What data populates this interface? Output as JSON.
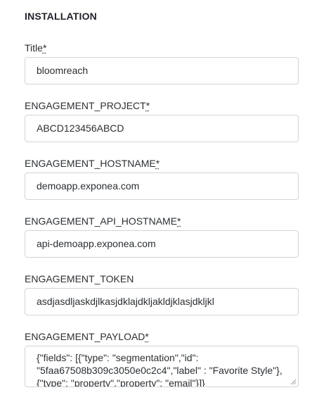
{
  "section_title": "INSTALLATION",
  "required_marker": "*",
  "fields": [
    {
      "label": "Title",
      "required": true,
      "value": "bloomreach"
    },
    {
      "label": "ENGAGEMENT_PROJECT",
      "required": true,
      "value": "ABCD123456ABCD"
    },
    {
      "label": "ENGAGEMENT_HOSTNAME",
      "required": true,
      "value": "demoapp.exponea.com"
    },
    {
      "label": "ENGAGEMENT_API_HOSTNAME",
      "required": true,
      "value": "api-demoapp.exponea.com"
    },
    {
      "label": "ENGAGEMENT_TOKEN",
      "required": false,
      "value": "asdjasdljaskdjlkasjdklajdkljakldjklasjdkljkl"
    },
    {
      "label": "ENGAGEMENT_PAYLOAD",
      "required": true,
      "value": "{\"fields\": [{\"type\": \"segmentation\",\"id\": \"5faa67508b309c3050e0c2c4\",\"label\" : \"Favorite Style\"},{\"type\": \"property\",\"property\": \"email\"}]}"
    }
  ]
}
